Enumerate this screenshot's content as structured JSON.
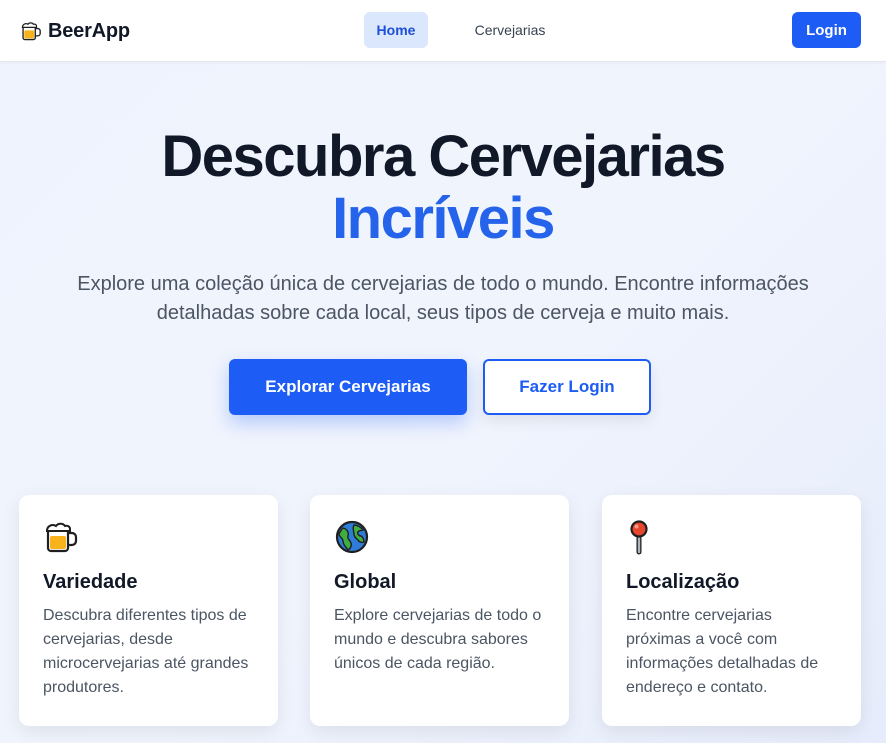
{
  "navbar": {
    "brand": "BeerApp",
    "brand_icon": "beer-mug-icon",
    "links": [
      {
        "label": "Home",
        "active": true
      },
      {
        "label": "Cervejarias",
        "active": false
      }
    ],
    "login_label": "Login"
  },
  "hero": {
    "title_line1": "Descubra Cervejarias",
    "title_line2": "Incríveis",
    "subtitle": "Explore uma coleção única de cervejarias de todo o mundo. Encontre informações detalhadas sobre cada local, seus tipos de cerveja e muito mais.",
    "primary_button": "Explorar Cervejarias",
    "secondary_button": "Fazer Login"
  },
  "features": [
    {
      "icon": "beer-mug-icon",
      "title": "Variedade",
      "text": "Descubra diferentes tipos de cervejarias, desde microcervejarias até grandes produtores."
    },
    {
      "icon": "globe-icon",
      "title": "Global",
      "text": "Explore cervejarias de todo o mundo e descubra sabores únicos de cada região."
    },
    {
      "icon": "pushpin-icon",
      "title": "Localização",
      "text": "Encontre cervejarias próximas a você com informações detalhadas de endereço e contato."
    }
  ],
  "colors": {
    "primary": "#1d5cf5",
    "accent_text": "#2563eb",
    "active_nav_bg": "#dbe7fc"
  }
}
